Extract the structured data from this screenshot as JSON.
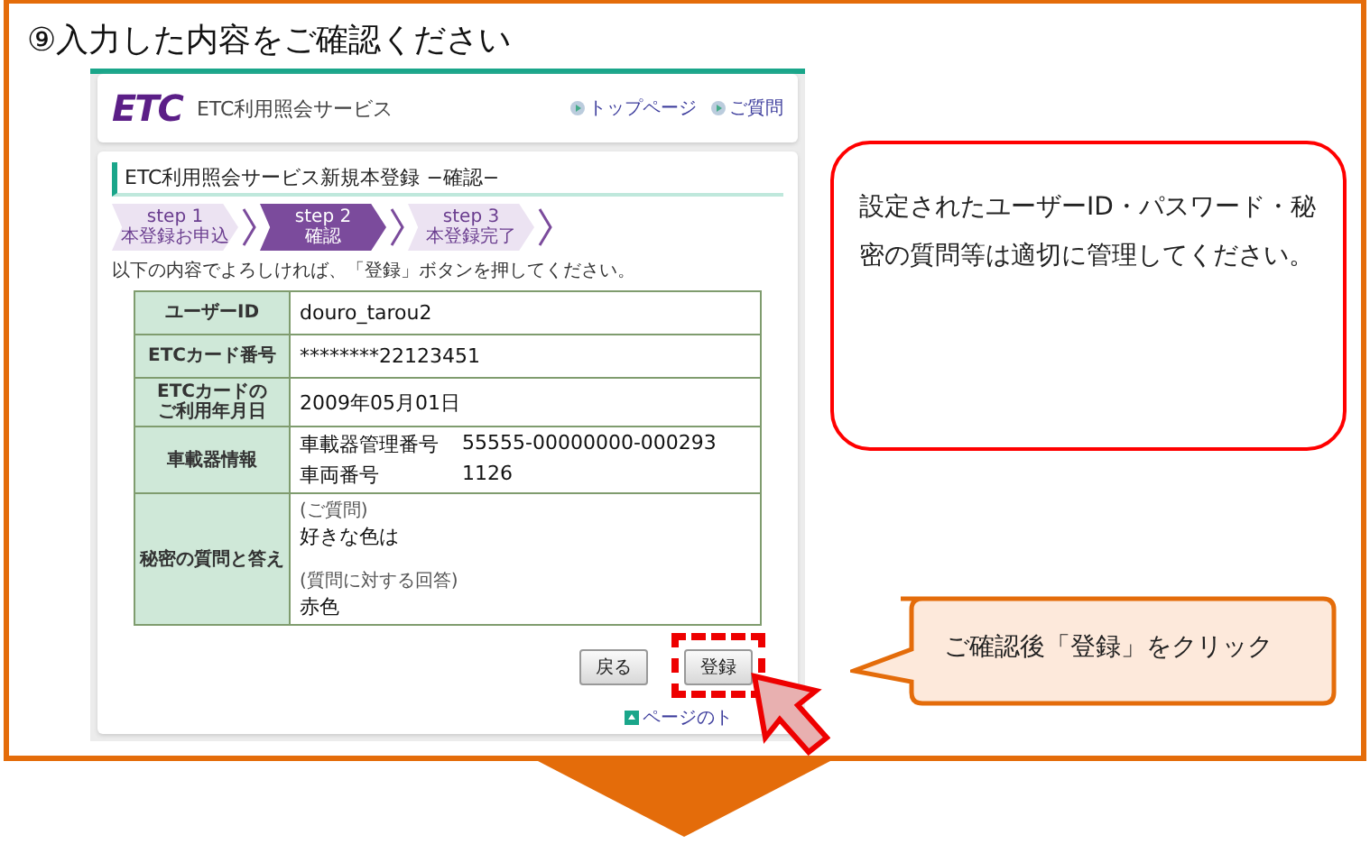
{
  "title": "⑨入力した内容をご確認ください",
  "site": {
    "logo": "ETC",
    "name": "ETC利用照会サービス",
    "links": [
      "トップページ",
      "ご質問"
    ]
  },
  "page_heading": "ETC利用照会サービス新規本登録 −確認−",
  "steps": [
    {
      "number": "step 1",
      "label": "本登録お申込",
      "selected": false
    },
    {
      "number": "step 2",
      "label": "確認",
      "selected": true
    },
    {
      "number": "step 3",
      "label": "本登録完了",
      "selected": false
    }
  ],
  "instruction": "以下の内容でよろしければ、「登録」ボタンを押してください。",
  "rows": [
    {
      "kind": "text",
      "label": "ユーザーID",
      "value": "douro_tarou2"
    },
    {
      "kind": "text",
      "label": "ETCカード番号",
      "value": "********22123451"
    },
    {
      "kind": "text",
      "label": [
        "ETCカードの",
        "ご利用年月日"
      ],
      "value": "2009年05月01日"
    },
    {
      "kind": "pairs",
      "label": "車載器情報",
      "entries": [
        {
          "name": "車載器管理番号",
          "value": "55555-00000000-000293"
        },
        {
          "name": "車両番号",
          "value": "1126"
        }
      ]
    },
    {
      "kind": "qa",
      "label": "秘密の質問と答え",
      "entries": [
        {
          "caption": "(ご質問)",
          "value": "好きな色は"
        },
        {
          "caption": "(質問に対する回答)",
          "value": "赤色"
        }
      ]
    }
  ],
  "buttons": [
    {
      "label": "戻る",
      "highlighted": false
    },
    {
      "label": "登録",
      "highlighted": true
    }
  ],
  "page_top_link": "ページのト",
  "note": "設定されたユーザーID・パスワード・秘密の質問等は適切に管理してください。",
  "callout": "ご確認後「登録」をクリック"
}
